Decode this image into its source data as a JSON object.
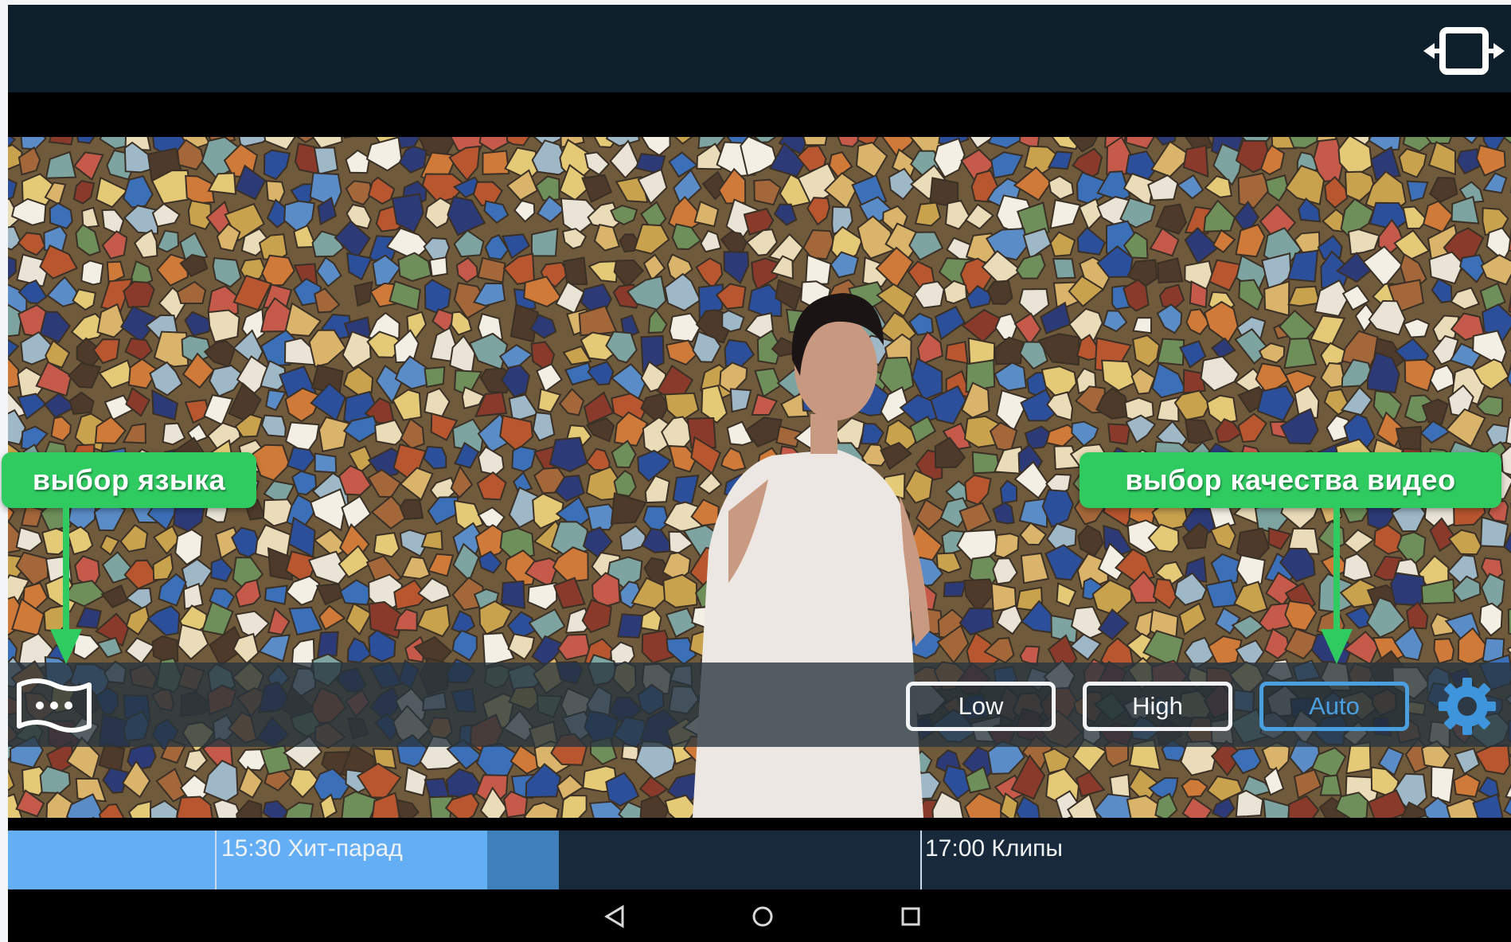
{
  "topbar": {
    "expand_icon": "expand-horizontal-icon"
  },
  "quality_buttons": [
    {
      "label": "Low",
      "selected": false
    },
    {
      "label": "High",
      "selected": false
    },
    {
      "label": "Auto",
      "selected": true
    }
  ],
  "controls": {
    "language_icon": "subtitles-flag-icon",
    "settings_icon": "gear-icon"
  },
  "timeline": {
    "programs": [
      {
        "time_title": "15:30 Хит-парад"
      },
      {
        "time_title": "17:00 Клипы"
      }
    ]
  },
  "navbar": {
    "back_icon": "back-triangle-icon",
    "home_icon": "home-circle-icon",
    "recents_icon": "recents-square-icon"
  },
  "callouts": {
    "language": "выбор языка",
    "quality": "выбор качества видео"
  },
  "colors": {
    "accent_green": "#2fcb61",
    "selected_blue": "#4a9fe0",
    "timeline_blue": "#63aef4",
    "topbar": "#0d1f2b"
  }
}
